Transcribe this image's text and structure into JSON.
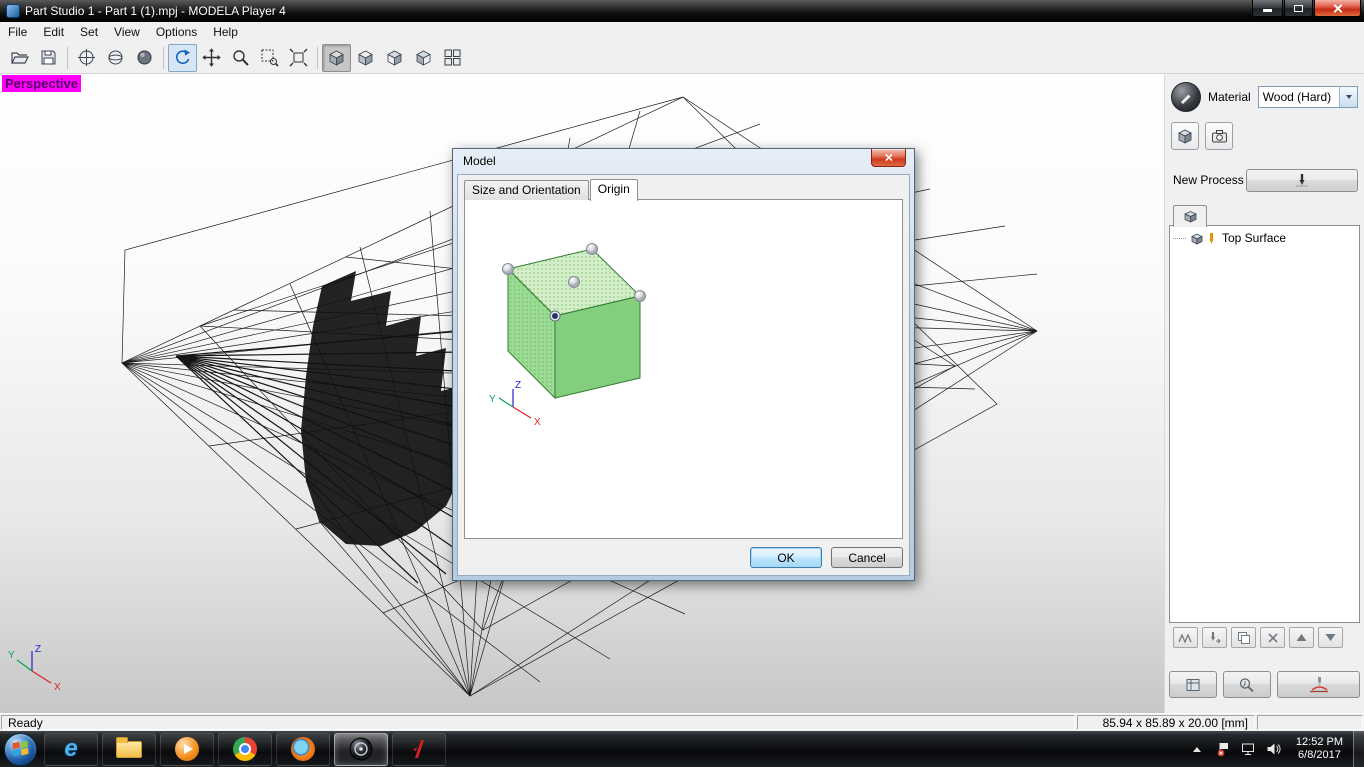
{
  "window": {
    "title": "Part Studio 1 - Part 1 (1).mpj - MODELA Player 4"
  },
  "menu": {
    "items": [
      "File",
      "Edit",
      "Set",
      "View",
      "Options",
      "Help"
    ]
  },
  "toolbar": {
    "buttons": [
      "open",
      "save",
      "render-wireframe",
      "render-hidden-line",
      "render-shaded",
      "rotate-view",
      "pan-view",
      "zoom-view",
      "zoom-window",
      "fit-view",
      "view-perspective",
      "view-top",
      "view-front",
      "view-side",
      "view-quad"
    ]
  },
  "viewport": {
    "perspective_label": "Perspective",
    "axis": {
      "x": "X",
      "y": "Y",
      "z": "Z"
    }
  },
  "dialog": {
    "title": "Model",
    "tabs": [
      "Size and Orientation",
      "Origin"
    ],
    "ok_label": "OK",
    "cancel_label": "Cancel",
    "axis": {
      "x": "X",
      "y": "Y",
      "z": "Z"
    }
  },
  "sidebar": {
    "material_label": "Material",
    "material_value": "Wood (Hard)",
    "new_process_label": "New Process",
    "tree": {
      "item": "Top Surface"
    }
  },
  "statusbar": {
    "ready": "Ready",
    "dimensions": "85.94 x 85.89 x 20.00 [mm]"
  },
  "taskbar": {
    "ie_glyph": "e",
    "time": "12:52 PM",
    "date": "6/8/2017"
  }
}
